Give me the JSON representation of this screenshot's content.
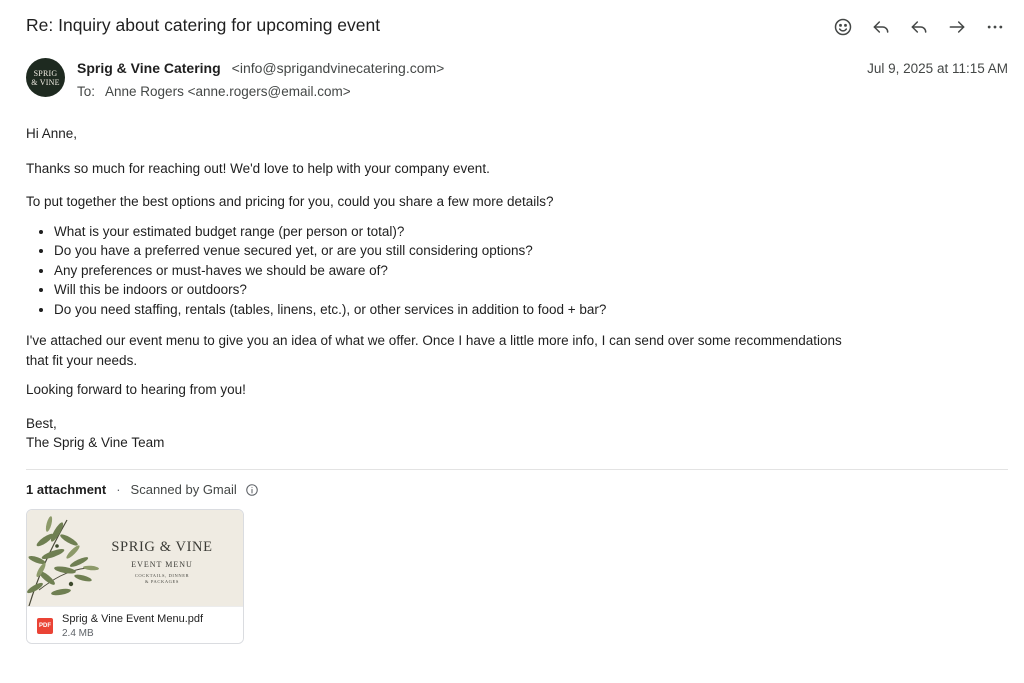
{
  "email": {
    "subject": "Re: Inquiry about catering for upcoming event",
    "sender": {
      "name": "Sprig & Vine Catering",
      "email": "<info@sprigandvinecatering.com>",
      "avatar_line1": "SPRIG",
      "avatar_line2": "& VINE"
    },
    "to_label": "To:",
    "to_value": "Anne Rogers <anne.rogers@email.com>",
    "date": "Jul 9, 2025 at 11:15 AM",
    "body": {
      "greeting": "Hi Anne,",
      "thanks": "Thanks so much for reaching out! We'd love to help with your company event.",
      "intro": "To put together the best options and pricing for you, could you share a few more details?",
      "bullets": [
        "What is your estimated budget range (per person or total)?",
        "Do you have a preferred venue secured yet, or are you still considering options?",
        "Any preferences or must-haves we should be aware of?",
        "Will this be indoors or outdoors?",
        "Do you need staffing, rentals (tables, linens, etc.), or other services in addition to food + bar?"
      ],
      "attached_line1": "I've attached our event menu to give you an idea of what we offer. Once I have a little more info, I can send over some recommendations",
      "attached_line2": "that fit your needs.",
      "looking": "Looking forward to hearing from you!",
      "signoff": "Best,",
      "signature": "The Sprig & Vine Team"
    }
  },
  "toolbar": {
    "icons": [
      "emoji-icon",
      "reply-icon",
      "reply-all-icon",
      "forward-icon",
      "more-icon"
    ]
  },
  "attachments": {
    "count_label": "1 attachment",
    "separator": "·",
    "scan_label": "Scanned by Gmail",
    "items": [
      {
        "thumb_title": "SPRIG & VINE",
        "thumb_subtitle": "EVENT MENU",
        "thumb_small_1": "COCKTAILS, DINNER",
        "thumb_small_2": "& PACKAGES",
        "file_type": "PDF",
        "name": "Sprig & Vine Event Menu.pdf",
        "size": "2.4 MB"
      }
    ]
  },
  "colors": {
    "avatar_bg": "#1e2a20",
    "pdf_red": "#ea4335",
    "text_primary": "#1f1f1f",
    "text_secondary": "#444746"
  }
}
